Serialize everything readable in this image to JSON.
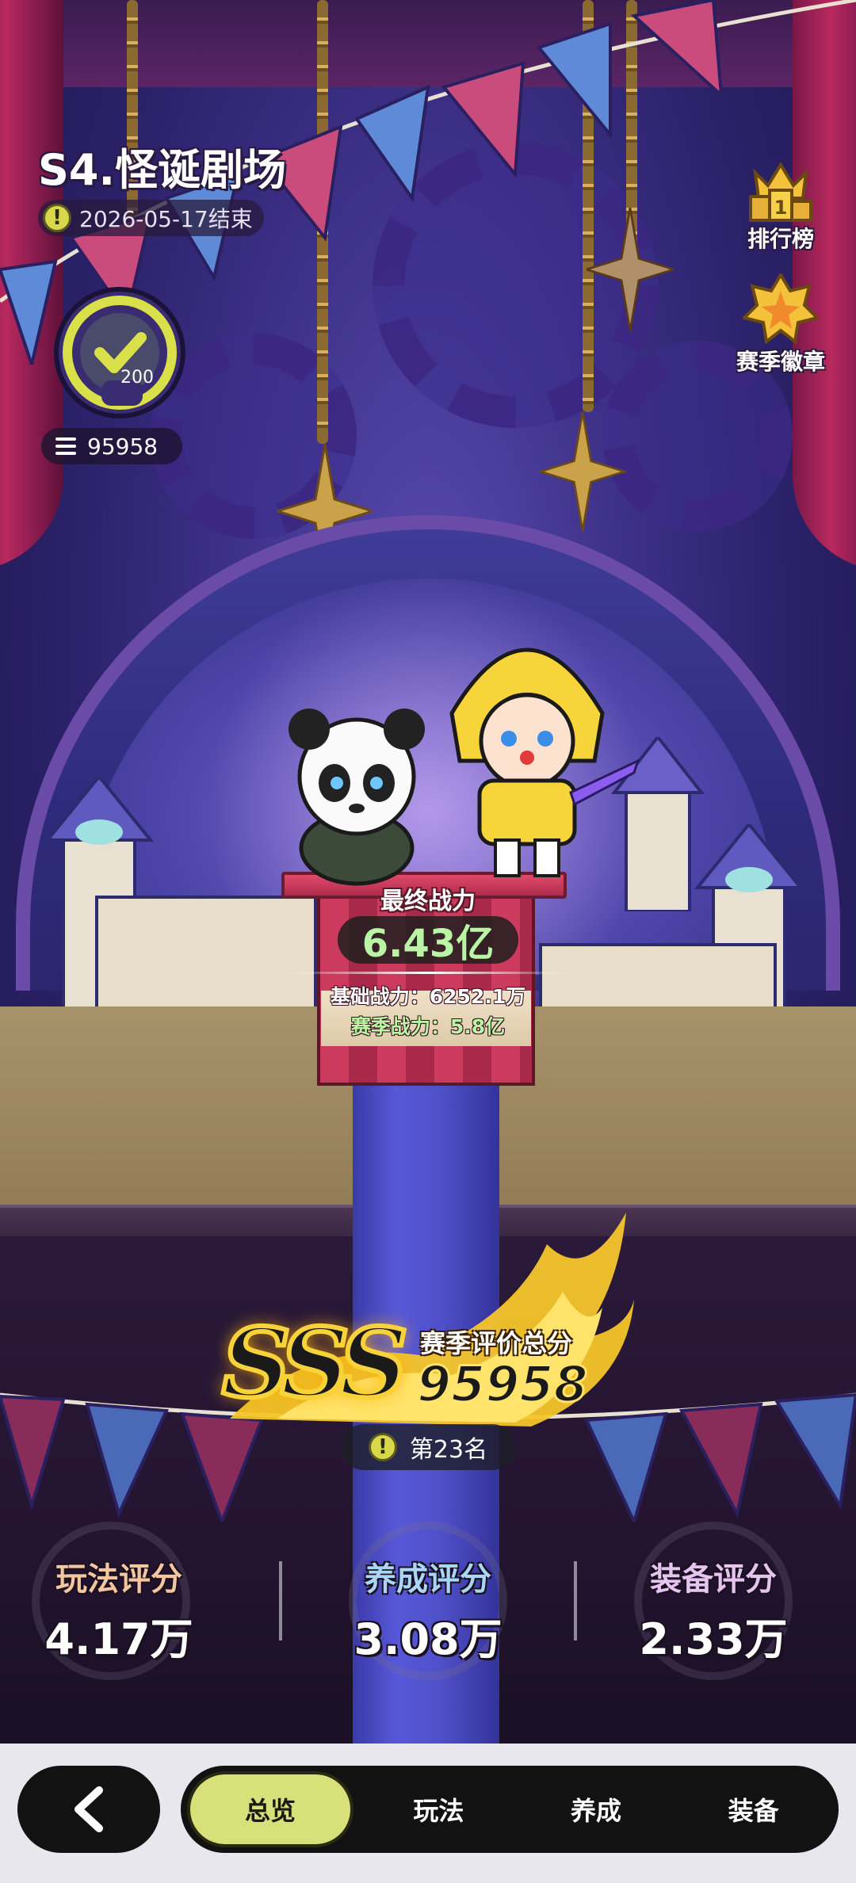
{
  "season": {
    "title": "S4.怪诞剧场",
    "end_date": "2026-05-17结束",
    "medal_level": "200",
    "score_total": "95958"
  },
  "side_buttons": {
    "ranking_label": "排行榜",
    "ranking_icon_text": "1",
    "badge_label": "赛季徽章"
  },
  "power": {
    "title": "最终战力",
    "value": "6.43亿",
    "base": "基础战力：6252.1万",
    "season": "赛季战力：5.8亿"
  },
  "rating": {
    "grade": "SSS",
    "label": "赛季评价总分",
    "score": "95958",
    "rank": "第23名"
  },
  "scores": [
    {
      "title": "玩法评分",
      "value": "4.17万",
      "color": "#f3c6a0"
    },
    {
      "title": "养成评分",
      "value": "3.08万",
      "color": "#a9d6f5"
    },
    {
      "title": "装备评分",
      "value": "2.33万",
      "color": "#e6c4f0"
    }
  ],
  "nav": {
    "back_icon": "chevron-left-icon",
    "tabs": [
      "总览",
      "玩法",
      "养成",
      "装备"
    ],
    "active_tab": "总览",
    "active_color": "#d8e07a"
  }
}
